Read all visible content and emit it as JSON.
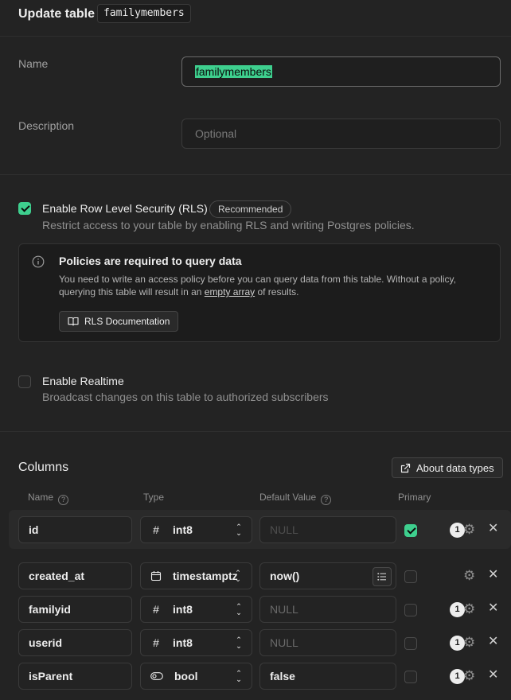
{
  "header": {
    "title": "Update table",
    "table_name": "familymembers"
  },
  "name_field": {
    "label": "Name",
    "value": "familymembers"
  },
  "description_field": {
    "label": "Description",
    "placeholder": "Optional"
  },
  "rls": {
    "checked": true,
    "label": "Enable Row Level Security (RLS)",
    "badge": "Recommended",
    "description": "Restrict access to your table by enabling RLS and writing Postgres policies."
  },
  "callout": {
    "title": "Policies are required to query data",
    "body_prefix": "You need to write an access policy before you can query data from this table. Without a policy, querying this table will result in an ",
    "body_link": "empty array",
    "body_suffix": " of results.",
    "button": "RLS Documentation"
  },
  "realtime": {
    "checked": false,
    "label": "Enable Realtime",
    "description": "Broadcast changes on this table to authorized subscribers"
  },
  "columns": {
    "title": "Columns",
    "about_button": "About data types",
    "headers": {
      "name": "Name",
      "type": "Type",
      "default": "Default Value",
      "primary": "Primary"
    },
    "rows": [
      {
        "name": "id",
        "type": "int8",
        "type_icon": "hash-icon",
        "default": "NULL",
        "primary": true,
        "badge": "1"
      },
      {
        "name": "created_at",
        "type": "timestamptz",
        "type_icon": "calendar-icon",
        "default": "now()",
        "primary": false,
        "badge": ""
      },
      {
        "name": "familyid",
        "type": "int8",
        "type_icon": "hash-icon",
        "default": "NULL",
        "primary": false,
        "badge": "1"
      },
      {
        "name": "userid",
        "type": "int8",
        "type_icon": "hash-icon",
        "default": "NULL",
        "primary": false,
        "badge": "1"
      },
      {
        "name": "isParent",
        "type": "bool",
        "type_icon": "toggle-icon",
        "default": "false",
        "primary": false,
        "badge": "1"
      }
    ]
  },
  "colors": {
    "accent": "#3ecf8e",
    "background": "#232323"
  }
}
